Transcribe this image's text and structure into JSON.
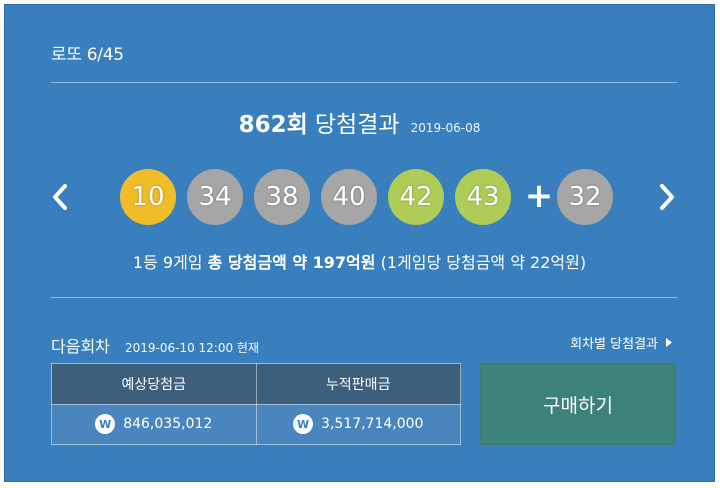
{
  "header": {
    "brand": "로또 6/45"
  },
  "draw": {
    "round": "862회",
    "label": "당첨결과",
    "date": "2019-06-08"
  },
  "balls": [
    {
      "number": "10",
      "color": "#f0bc2a"
    },
    {
      "number": "34",
      "color": "#a6a6a6"
    },
    {
      "number": "38",
      "color": "#a6a6a6"
    },
    {
      "number": "40",
      "color": "#a6a6a6"
    },
    {
      "number": "42",
      "color": "#afcc57"
    },
    {
      "number": "43",
      "color": "#afcc57"
    }
  ],
  "bonus": {
    "plus": "+",
    "number": "32",
    "color": "#a6a6a6"
  },
  "prize": {
    "part1": "1등 9게임",
    "part2": "총 당첨금액 약 197억원",
    "part3": "(1게임당 당첨금액 약 22억원)"
  },
  "next": {
    "title": "다음회차",
    "datetime": "2019-06-10 12:00 현재",
    "history_link": "회차별 당첨결과",
    "table": {
      "col1_header": "예상당첨금",
      "col2_header": "누적판매금",
      "col1_value": "846,035,012",
      "col2_value": "3,517,714,000",
      "won_symbol": "W"
    },
    "buy_label": "구매하기"
  }
}
